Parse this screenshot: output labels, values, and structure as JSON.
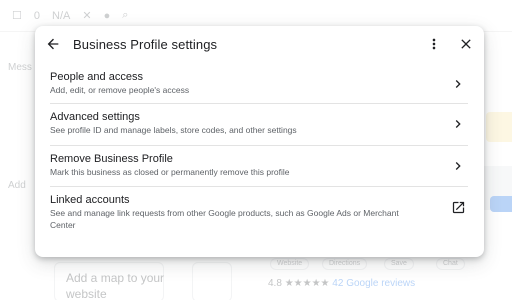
{
  "background": {
    "toolbar": {
      "count_1": "0",
      "count_2": "N/A"
    },
    "left_labels": [
      "Mess",
      "Add",
      "Add"
    ],
    "map_prompt": "Add a map to your website",
    "rating": {
      "score": "4.8",
      "reviews_link": "42 Google reviews"
    },
    "chips": [
      "Website",
      "Directions",
      "Save",
      "Chat"
    ]
  },
  "dialog": {
    "title": "Business Profile settings",
    "items": [
      {
        "title": "People and access",
        "description": "Add, edit, or remove people's access",
        "action_icon": "chevron-right-icon"
      },
      {
        "title": "Advanced settings",
        "description": "See profile ID and manage labels, store codes, and other settings",
        "action_icon": "chevron-right-icon"
      },
      {
        "title": "Remove Business Profile",
        "description": "Mark this business as closed or permanently remove this profile",
        "action_icon": "chevron-right-icon"
      },
      {
        "title": "Linked accounts",
        "description": "See and manage link requests from other Google products, such as Google Ads or Merchant Center",
        "action_icon": "open-in-new-icon"
      }
    ]
  },
  "colors": {
    "title_text": "#202124",
    "secondary_text": "#5f6368",
    "divider": "#e3e3e3",
    "link": "#1a73e8"
  }
}
